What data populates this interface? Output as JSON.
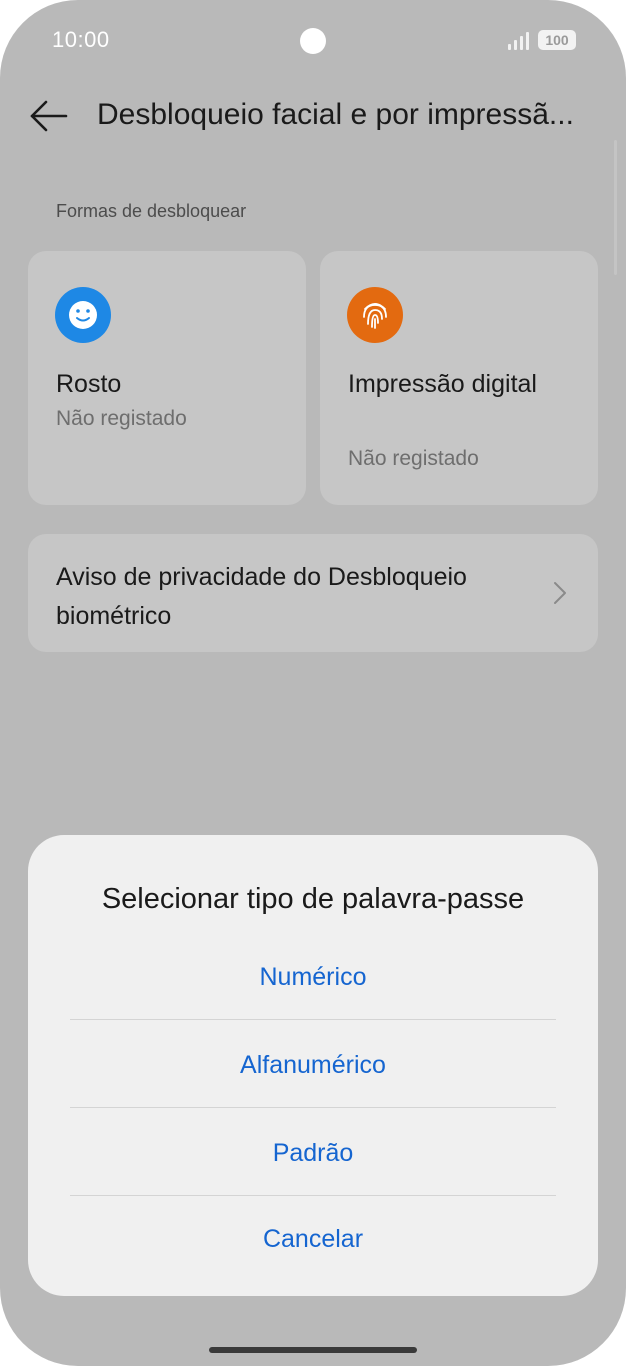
{
  "status_bar": {
    "time": "10:00",
    "battery": "100",
    "signal_icon": "signal-bars-icon",
    "camera_icon": "front-camera-icon"
  },
  "header": {
    "back_icon": "arrow-left-icon",
    "title": "Desbloqueio facial e por impressã..."
  },
  "section": {
    "label": "Formas de desbloquear"
  },
  "unlock_methods": [
    {
      "icon": "face-icon",
      "icon_color": "#1e88e5",
      "title": "Rosto",
      "status": "Não registado"
    },
    {
      "icon": "fingerprint-icon",
      "icon_color": "#e36a10",
      "title": "Impressão digital",
      "status": "Não registado"
    }
  ],
  "privacy": {
    "label": "Aviso de privacidade do Desbloqueio biométrico",
    "chevron_icon": "chevron-right-icon"
  },
  "dialog": {
    "title": "Selecionar tipo de palavra-passe",
    "options": [
      "Numérico",
      "Alfanumérico",
      "Padrão",
      "Cancelar"
    ],
    "option_color": "#1565d0"
  }
}
